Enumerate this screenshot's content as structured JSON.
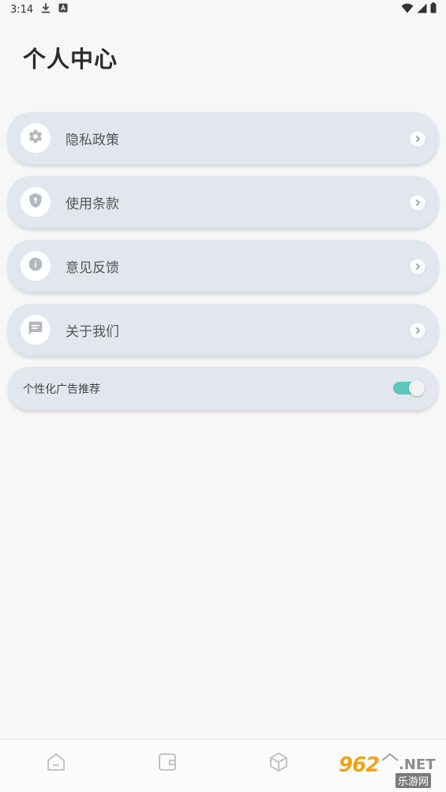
{
  "status_bar": {
    "time": "3:14",
    "icons": [
      "download-icon",
      "a-box-icon",
      "wifi-icon",
      "cellular-icon",
      "battery-icon"
    ]
  },
  "page": {
    "title": "个人中心"
  },
  "menu": [
    {
      "label": "隐私政策",
      "icon": "gear-icon"
    },
    {
      "label": "使用条款",
      "icon": "shield-icon"
    },
    {
      "label": "意见反馈",
      "icon": "info-icon"
    },
    {
      "label": "关于我们",
      "icon": "message-icon"
    }
  ],
  "personalized_ads": {
    "label": "个性化广告推荐",
    "enabled": true
  },
  "bottom_nav": {
    "items": [
      "home-icon",
      "wallet-icon",
      "cube-icon",
      "profile-icon"
    ]
  },
  "watermark": {
    "number": "962",
    "suffix": ".NET",
    "name": "乐游网"
  },
  "colors": {
    "card_bg": "#e2e6ee",
    "toggle_on": "#5bc8be",
    "background": "#f7f7f7"
  }
}
